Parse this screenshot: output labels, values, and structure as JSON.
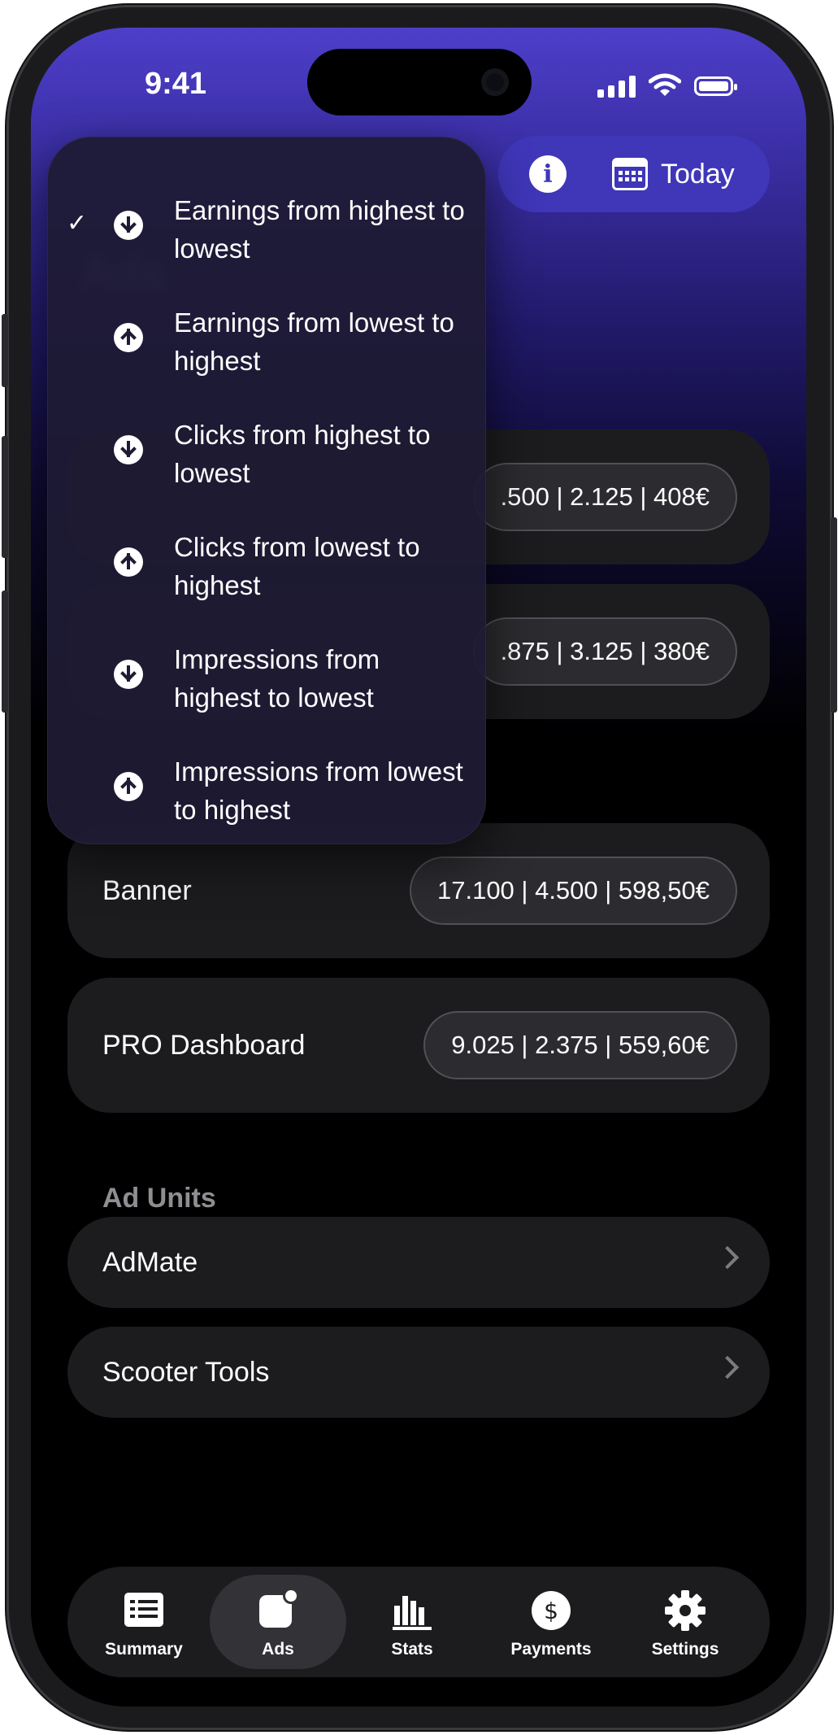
{
  "status_bar": {
    "time": "9:41"
  },
  "header": {
    "today_label": "Today"
  },
  "sort_menu": {
    "items": [
      {
        "label": "Earnings from highest to lowest",
        "direction": "down",
        "selected": true
      },
      {
        "label": "Earnings from lowest to highest",
        "direction": "up",
        "selected": false
      },
      {
        "label": "Clicks from highest to lowest",
        "direction": "down",
        "selected": false
      },
      {
        "label": "Clicks from lowest to highest",
        "direction": "up",
        "selected": false
      },
      {
        "label": "Impressions from highest to lowest",
        "direction": "down",
        "selected": false
      },
      {
        "label": "Impressions from lowest to highest",
        "direction": "up",
        "selected": false
      }
    ],
    "check_mark": "✓"
  },
  "placements": [
    {
      "label": "",
      "stats": ".500 | 2.125 | 408€"
    },
    {
      "label": "",
      "stats": ".875 | 3.125 | 380€"
    },
    {
      "label": "Banner",
      "stats": "17.100 | 4.500 | 598,50€"
    },
    {
      "label": "PRO Dashboard",
      "stats": "9.025 | 2.375 | 559,60€"
    }
  ],
  "ad_units": {
    "title": "Ad Units",
    "items": [
      {
        "label": "AdMate"
      },
      {
        "label": "Scooter Tools"
      }
    ]
  },
  "tab_bar": {
    "tabs": [
      {
        "label": "Summary",
        "icon": "list-icon",
        "active": false
      },
      {
        "label": "Ads",
        "icon": "ads-badge-icon",
        "active": true
      },
      {
        "label": "Stats",
        "icon": "bar-chart-icon",
        "active": false
      },
      {
        "label": "Payments",
        "icon": "dollar-icon",
        "active": false
      },
      {
        "label": "Settings",
        "icon": "gear-icon",
        "active": false
      }
    ]
  },
  "colors": {
    "accent": "#3f36b8",
    "card": "#1c1c1f",
    "menu": "#1e1b34"
  }
}
